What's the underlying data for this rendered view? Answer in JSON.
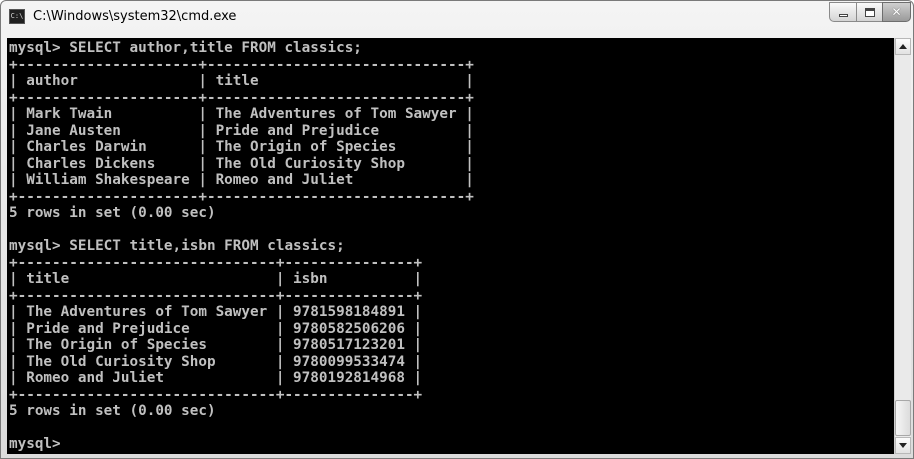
{
  "window": {
    "title": "C:\\Windows\\system32\\cmd.exe",
    "icon_label": "C:\\",
    "buttons": {
      "minimize": "minimize-icon",
      "maximize": "maximize-icon",
      "close": "close-icon",
      "close_glyph": "✕"
    }
  },
  "console": {
    "lines": [
      "mysql> SELECT author,title FROM classics;",
      "+---------------------+------------------------------+",
      "| author              | title                        |",
      "+---------------------+------------------------------+",
      "| Mark Twain          | The Adventures of Tom Sawyer |",
      "| Jane Austen         | Pride and Prejudice          |",
      "| Charles Darwin      | The Origin of Species        |",
      "| Charles Dickens     | The Old Curiosity Shop       |",
      "| William Shakespeare | Romeo and Juliet             |",
      "+---------------------+------------------------------+",
      "5 rows in set (0.00 sec)",
      "",
      "mysql> SELECT title,isbn FROM classics;",
      "+------------------------------+---------------+",
      "| title                        | isbn          |",
      "+------------------------------+---------------+",
      "| The Adventures of Tom Sawyer | 9781598184891 |",
      "| Pride and Prejudice          | 9780582506206 |",
      "| The Origin of Species        | 9780517123201 |",
      "| The Old Curiosity Shop       | 9780099533474 |",
      "| Romeo and Juliet             | 9780192814968 |",
      "+------------------------------+---------------+",
      "5 rows in set (0.00 sec)",
      "",
      "mysql>"
    ],
    "text_color": "#c0c0c0",
    "background": "#000000"
  },
  "scrollbar": {
    "position_fraction": 0.93
  }
}
